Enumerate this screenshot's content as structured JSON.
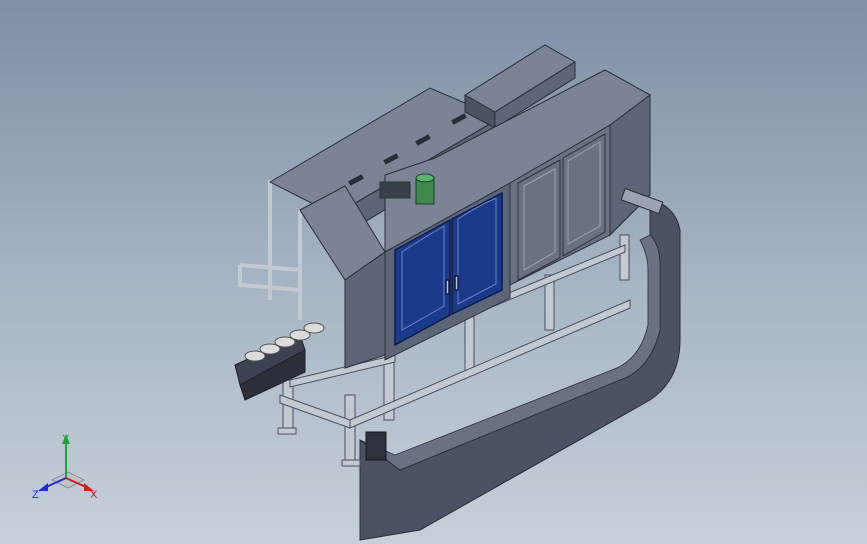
{
  "viewport": {
    "background_top": "#7e8fa6",
    "background_bottom": "#c7d0da"
  },
  "model": {
    "frame_color": "#c3c9d1",
    "panel_color": "#5d6578",
    "panel_top_color": "#7c8396",
    "door_color": "#1c3a8c",
    "motor_color": "#3e8a4e",
    "curved_guard_color": "#4c5263"
  },
  "triad": {
    "x_label": "X",
    "y_label": "Y",
    "z_label": "Z",
    "x_color": "#d11f1f",
    "y_color": "#1ea33c",
    "z_color": "#1f2fd1"
  }
}
